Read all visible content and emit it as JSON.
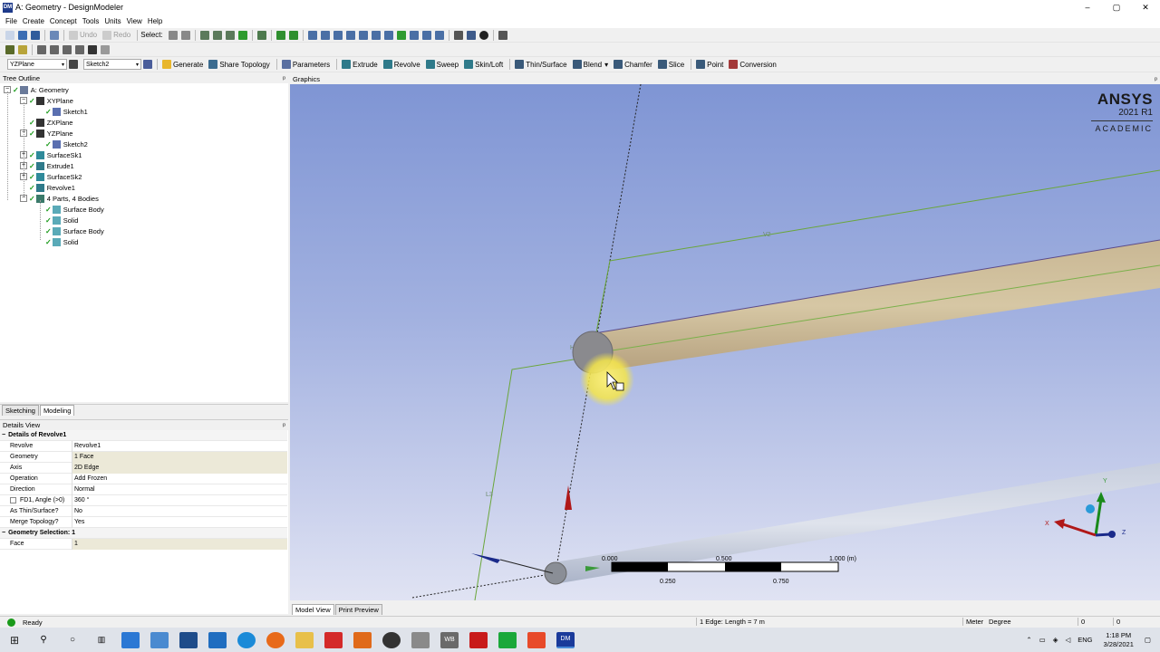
{
  "window": {
    "title": "A: Geometry - DesignModeler",
    "app_icon": "DM",
    "controls": [
      "–",
      "▢",
      "✕"
    ]
  },
  "menu": [
    "File",
    "Create",
    "Concept",
    "Tools",
    "Units",
    "View",
    "Help"
  ],
  "toolbar1": {
    "undo": "Undo",
    "redo": "Redo",
    "select": "Select:"
  },
  "toolbar3": {
    "plane": "YZPlane",
    "sketch": "Sketch2",
    "generate": "Generate",
    "share_topology": "Share Topology",
    "parameters": "Parameters",
    "extrude": "Extrude",
    "revolve": "Revolve",
    "sweep": "Sweep",
    "skin_loft": "Skin/Loft",
    "thin_surface": "Thin/Surface",
    "blend": "Blend",
    "chamfer": "Chamfer",
    "slice": "Slice",
    "point": "Point",
    "conversion": "Conversion"
  },
  "tree": {
    "header": "Tree Outline",
    "pin": "ᵖ",
    "items": [
      {
        "label": "A: Geometry",
        "icon": "geometry-icon"
      },
      {
        "label": "XYPlane",
        "icon": "plane-axes-icon"
      },
      {
        "label": "Sketch1",
        "icon": "sketch-icon"
      },
      {
        "label": "ZXPlane",
        "icon": "plane-axes-icon"
      },
      {
        "label": "YZPlane",
        "icon": "plane-axes-icon"
      },
      {
        "label": "Sketch2",
        "icon": "sketch-icon"
      },
      {
        "label": "SurfaceSk1",
        "icon": "surface-sketch-icon"
      },
      {
        "label": "Extrude1",
        "icon": "extrude-icon"
      },
      {
        "label": "SurfaceSk2",
        "icon": "surface-sketch-icon"
      },
      {
        "label": "Revolve1",
        "icon": "revolve-icon"
      },
      {
        "label": "4 Parts, 4 Bodies",
        "icon": "parts-icon"
      },
      {
        "label": "Surface Body",
        "icon": "surface-body-icon"
      },
      {
        "label": "Solid",
        "icon": "solid-body-icon"
      },
      {
        "label": "Surface Body",
        "icon": "surface-body-icon"
      },
      {
        "label": "Solid",
        "icon": "solid-body-icon"
      }
    ]
  },
  "tabs": {
    "sketching": "Sketching",
    "modeling": "Modeling"
  },
  "details": {
    "header": "Details View",
    "group1": "Details of Revolve1",
    "rows": [
      {
        "key": "Revolve",
        "value": "Revolve1"
      },
      {
        "key": "Geometry",
        "value": "1 Face"
      },
      {
        "key": "Axis",
        "value": "2D Edge"
      },
      {
        "key": "Operation",
        "value": "Add Frozen"
      },
      {
        "key": "Direction",
        "value": "Normal"
      },
      {
        "key": "FD1, Angle (>0)",
        "value": "360 °"
      },
      {
        "key": "As Thin/Surface?",
        "value": "No"
      },
      {
        "key": "Merge Topology?",
        "value": "Yes"
      }
    ],
    "group2": "Geometry Selection: 1",
    "rows2": [
      {
        "key": "Face",
        "value": "1"
      }
    ]
  },
  "graphics": {
    "header": "Graphics",
    "logo_main": "ANSYS",
    "logo_version": "2021 R1",
    "logo_sub": "ACADEMIC",
    "dim_v2": "V2",
    "dim_l3": "L3",
    "dim_h": "H",
    "scale": {
      "t0": "0.000",
      "t1": "0.500",
      "t2": "1.000 (m)",
      "b1": "0.250",
      "b2": "0.750"
    },
    "triad": {
      "x": "X",
      "y": "Y",
      "z": "Z"
    }
  },
  "graphics_tabs": {
    "model_view": "Model View",
    "print_preview": "Print Preview"
  },
  "status": {
    "state": "Ready",
    "selection": "1 Edge: Length = 7 m",
    "units_len": "Meter",
    "units_ang": "Degree",
    "v1": "0",
    "v2": "0"
  },
  "taskbar": {
    "time": "1:18 PM",
    "date": "3/28/2021",
    "lang": "ENG",
    "wb": "WB",
    "dm": "DM"
  }
}
